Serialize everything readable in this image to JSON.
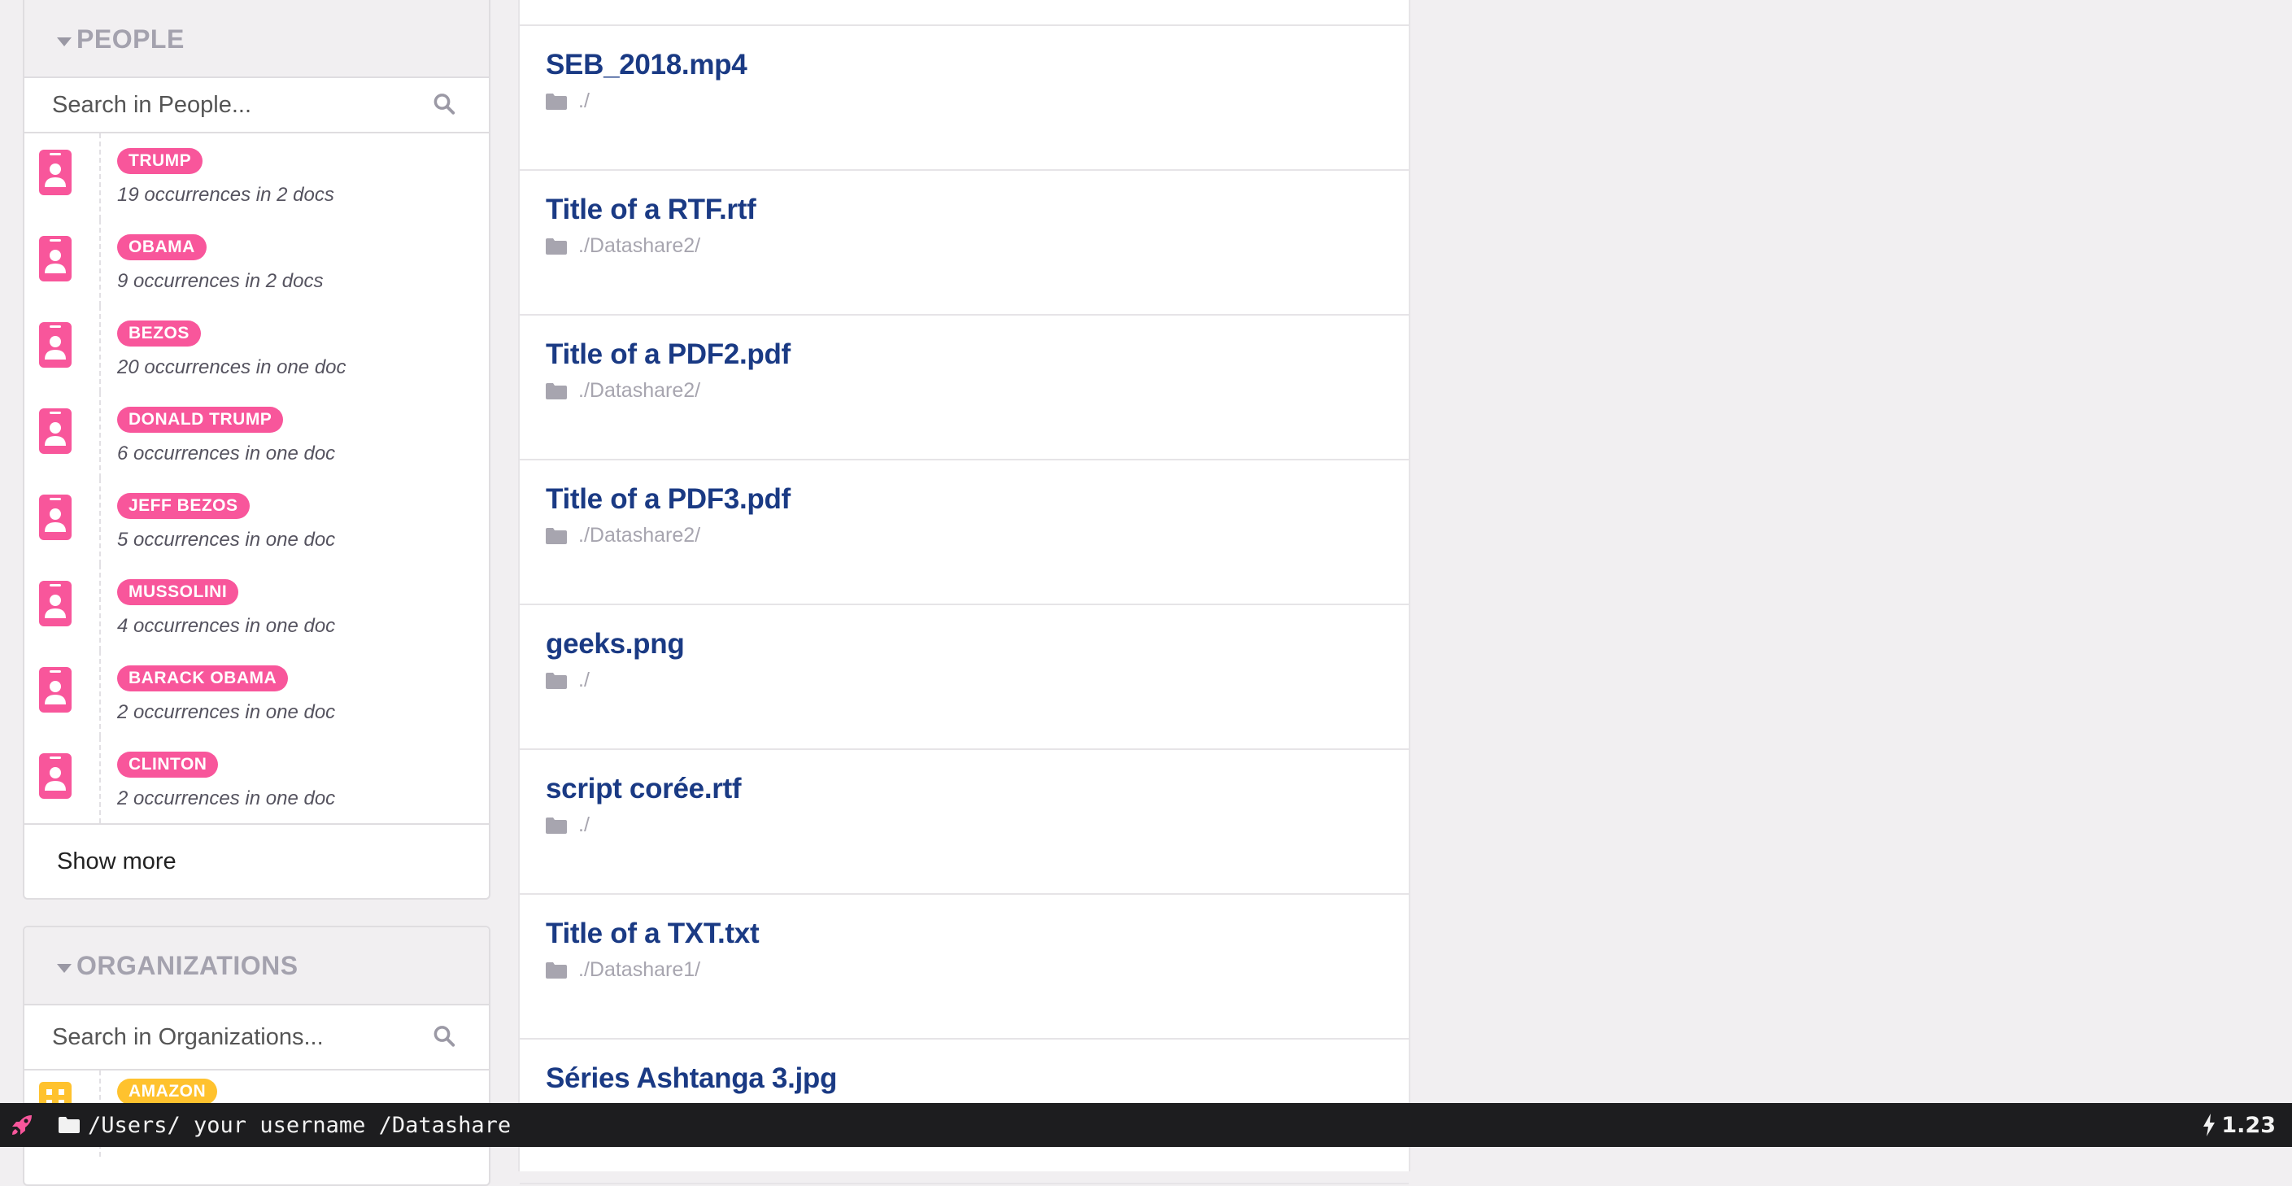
{
  "people_facet": {
    "title": "PEOPLE",
    "search_placeholder": "Search in People...",
    "items": [
      {
        "name": "TRUMP",
        "occurrences": "19 occurrences in 2 docs"
      },
      {
        "name": "OBAMA",
        "occurrences": "9 occurrences in 2 docs"
      },
      {
        "name": "BEZOS",
        "occurrences": "20 occurrences in one doc"
      },
      {
        "name": "DONALD TRUMP",
        "occurrences": "6 occurrences in one doc"
      },
      {
        "name": "JEFF BEZOS",
        "occurrences": "5 occurrences in one doc"
      },
      {
        "name": "MUSSOLINI",
        "occurrences": "4 occurrences in one doc"
      },
      {
        "name": "BARACK OBAMA",
        "occurrences": "2 occurrences in one doc"
      },
      {
        "name": "CLINTON",
        "occurrences": "2 occurrences in one doc"
      }
    ],
    "show_more_label": "Show more"
  },
  "organizations_facet": {
    "title": "ORGANIZATIONS",
    "search_placeholder": "Search in Organizations...",
    "items": [
      {
        "name": "AMAZON"
      }
    ]
  },
  "documents": [
    {
      "title": "SEB_2018.mp4",
      "path": "./"
    },
    {
      "title": "Title of a RTF.rtf",
      "path": "./Datashare2/"
    },
    {
      "title": "Title of a PDF2.pdf",
      "path": "./Datashare2/"
    },
    {
      "title": "Title of a PDF3.pdf",
      "path": "./Datashare2/"
    },
    {
      "title": "geeks.png",
      "path": "./"
    },
    {
      "title": "script corée.rtf",
      "path": "./"
    },
    {
      "title": "Title of a TXT.txt",
      "path": "./Datashare1/"
    },
    {
      "title": "Séries Ashtanga 3.jpg",
      "path": ""
    }
  ],
  "status_bar": {
    "data_dir": "/Users/ your username /Datashare",
    "version": "1.23"
  },
  "colors": {
    "person": "#f8569b",
    "organization": "#ffc22e",
    "doc_title": "#1a3a84"
  },
  "icons": {
    "person": "person-badge-icon",
    "organization": "organization-icon",
    "search": "search-icon",
    "folder": "folder-icon",
    "rocket": "rocket-icon",
    "bolt": "bolt-icon"
  }
}
